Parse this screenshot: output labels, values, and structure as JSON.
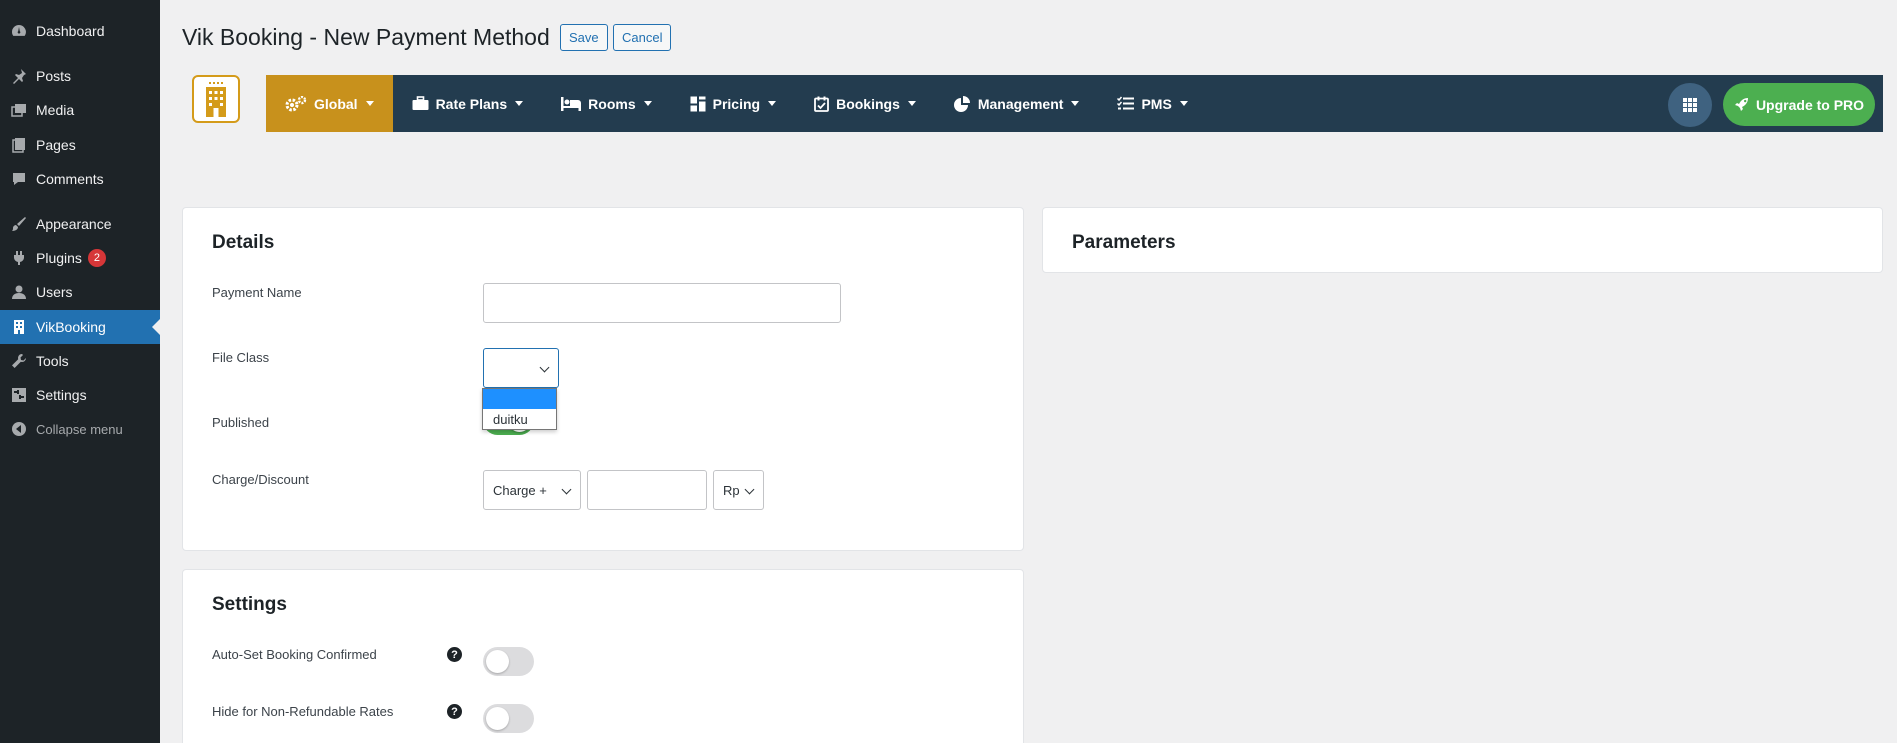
{
  "sidebar": {
    "items": [
      {
        "label": "Dashboard",
        "icon": "dashboard-icon"
      },
      {
        "label": "Posts",
        "icon": "pin-icon"
      },
      {
        "label": "Media",
        "icon": "media-icon"
      },
      {
        "label": "Pages",
        "icon": "pages-icon"
      },
      {
        "label": "Comments",
        "icon": "comments-icon"
      },
      {
        "label": "Appearance",
        "icon": "brush-icon"
      },
      {
        "label": "Plugins",
        "icon": "plugin-icon",
        "badge": "2"
      },
      {
        "label": "Users",
        "icon": "user-icon"
      },
      {
        "label": "VikBooking",
        "icon": "building-icon",
        "active": true
      },
      {
        "label": "Tools",
        "icon": "wrench-icon"
      },
      {
        "label": "Settings",
        "icon": "settings-icon"
      },
      {
        "label": "Collapse menu",
        "icon": "collapse-icon"
      }
    ]
  },
  "header": {
    "title": "Vik Booking - New Payment Method",
    "save_label": "Save",
    "cancel_label": "Cancel"
  },
  "nav": {
    "items": [
      {
        "label": "Global",
        "icon": "gears-icon",
        "active": true
      },
      {
        "label": "Rate Plans",
        "icon": "briefcase-icon"
      },
      {
        "label": "Rooms",
        "icon": "bed-icon"
      },
      {
        "label": "Pricing",
        "icon": "pricing-icon"
      },
      {
        "label": "Bookings",
        "icon": "calendar-check-icon"
      },
      {
        "label": "Management",
        "icon": "pie-chart-icon"
      },
      {
        "label": "PMS",
        "icon": "list-check-icon"
      }
    ],
    "upgrade_label": "Upgrade to PRO",
    "colors": {
      "bar": "#233c4f",
      "active": "#c8911c",
      "upgrade": "#4caf50"
    }
  },
  "details": {
    "title": "Details",
    "payment_name_label": "Payment Name",
    "payment_name_value": "",
    "file_class_label": "File Class",
    "file_class_value": "",
    "file_class_options": [
      "",
      "duitku"
    ],
    "published_label": "Published",
    "published_on": true,
    "charge_label": "Charge/Discount",
    "charge_type_value": "Charge +",
    "charge_amount_value": "",
    "charge_unit_value": "Rp"
  },
  "parameters": {
    "title": "Parameters"
  },
  "settings": {
    "title": "Settings",
    "auto_confirm_label": "Auto-Set Booking Confirmed",
    "hide_nonrefund_label": "Hide for Non-Refundable Rates",
    "help_glyph": "?"
  }
}
